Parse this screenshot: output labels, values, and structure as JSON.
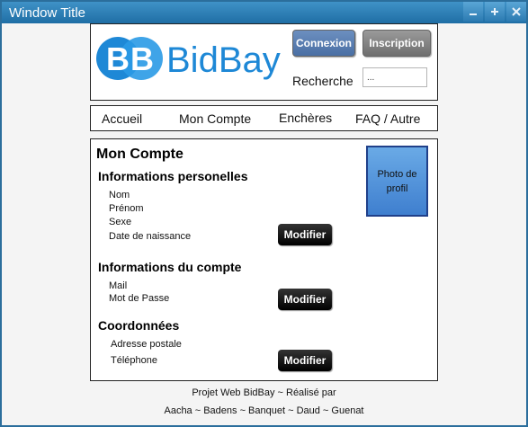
{
  "window": {
    "title": "Window Title",
    "buttons": [
      {
        "name": "minimize",
        "icon": "minimize-icon"
      },
      {
        "name": "maximize",
        "icon": "plus-icon"
      },
      {
        "name": "close",
        "icon": "close-icon"
      }
    ]
  },
  "header": {
    "logo_text": "BidBay",
    "logo_mark": "BB",
    "connexion_label": "Connexion",
    "inscription_label": "Inscription",
    "search_label": "Recherche",
    "search_value": "..."
  },
  "nav": {
    "items": [
      "Accueil",
      "Mon Compte",
      "Enchères",
      "FAQ / Autre"
    ]
  },
  "main": {
    "page_title": "Mon Compte",
    "photo_label": "Photo de profil",
    "sections": [
      {
        "title": "Informations personelles",
        "fields": [
          "Nom",
          "Prénom",
          "Sexe",
          "Date de naissance"
        ],
        "button": "Modifier"
      },
      {
        "title": "Informations du compte",
        "fields": [
          "Mail",
          "Mot de Passe"
        ],
        "button": "Modifier"
      },
      {
        "title": "Coordonnées",
        "fields": [
          "Adresse postale",
          "Téléphone"
        ],
        "button": "Modifier"
      }
    ]
  },
  "footer": {
    "line1": "Projet Web BidBay ~ Réalisé par",
    "line2": "Aacha ~ Badens ~ Banquet ~ Daud ~ Guenat"
  },
  "colors": {
    "titlebar": "#2b7ab1",
    "logo_blue": "#1e88d6",
    "connexion_button": "#4a6fa4",
    "inscription_button": "#6f6f6f",
    "modifier_button": "#000000",
    "photo_fill": "#4a8ee0"
  }
}
